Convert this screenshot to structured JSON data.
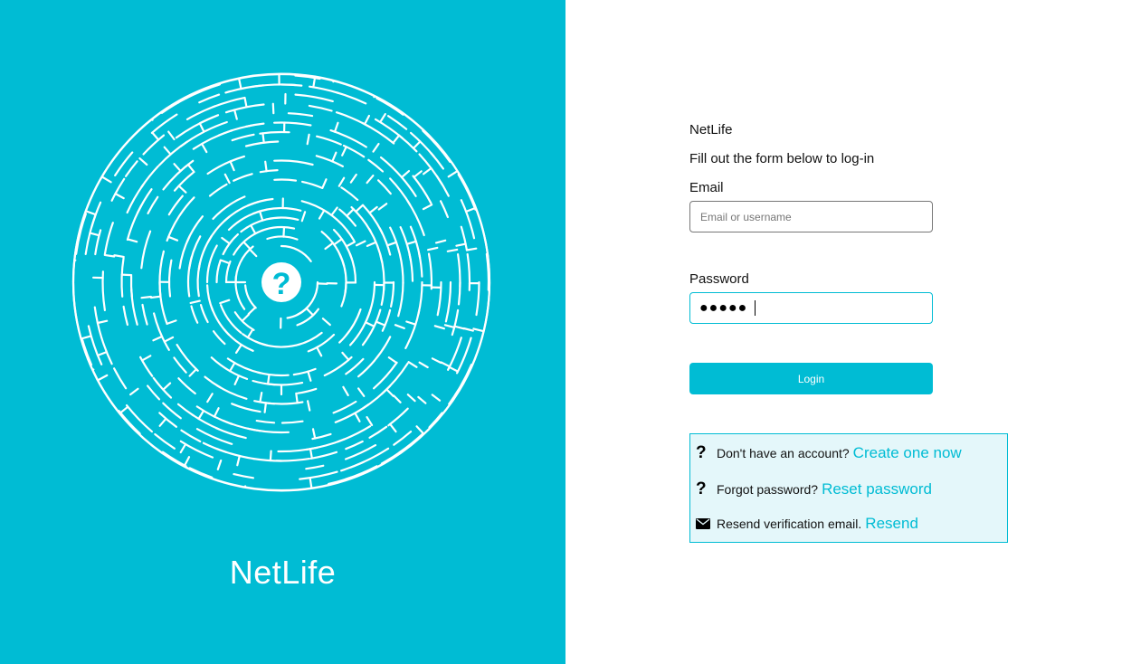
{
  "brand": {
    "title": "NetLife",
    "logo_icon": "maze-question-icon",
    "logo_glyph": "?",
    "background_color": "#00bcd4"
  },
  "form": {
    "app_name": "NetLife",
    "subtitle": "Fill out the form below to log-in",
    "email_label": "Email",
    "email_placeholder": "Email or username",
    "email_value": "",
    "password_label": "Password",
    "password_value": "●●●●●",
    "login_label": "Login"
  },
  "help": {
    "rows": [
      {
        "icon": "question-icon",
        "glyph": "?",
        "text": "Don't have an account?",
        "link": "Create one now"
      },
      {
        "icon": "question-icon",
        "glyph": "?",
        "text": "Forgot password?",
        "link": "Reset password"
      },
      {
        "icon": "envelope-icon",
        "text": "Resend verification email.",
        "link": "Resend"
      }
    ]
  },
  "colors": {
    "accent": "#00bcd4",
    "help_box_background": "#e4f7fa"
  }
}
